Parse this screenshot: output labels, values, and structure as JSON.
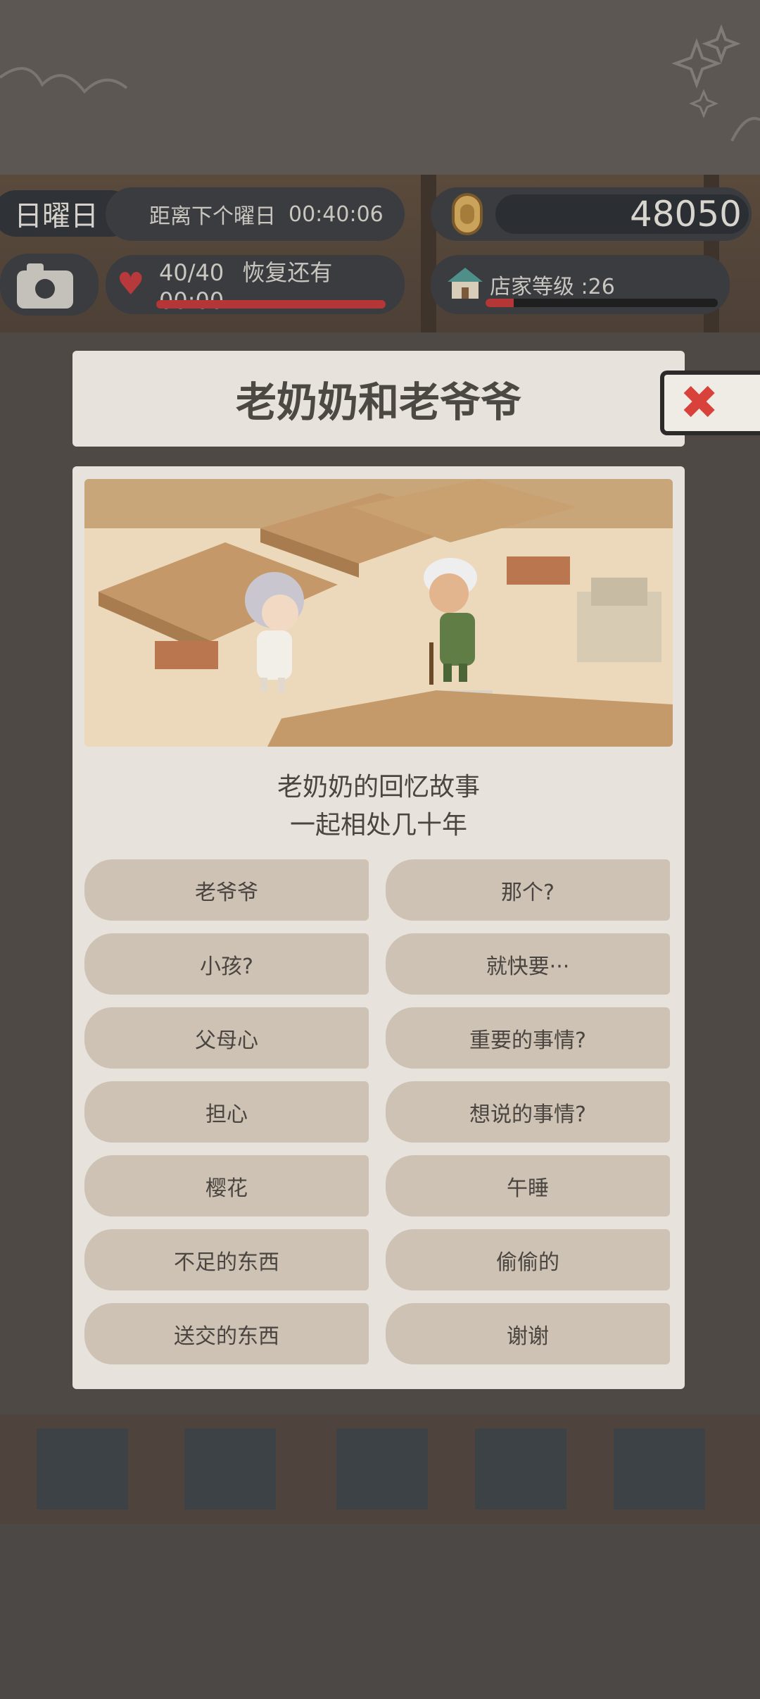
{
  "hud": {
    "day": "日曜日",
    "next_day_label": "距离下个曜日",
    "next_day_timer": "00:40:06",
    "coins": "48050",
    "stamina": "40/40",
    "recover_label": "恢复还有",
    "recover_timer": "00:00",
    "shop_level": "店家等级 :26",
    "stamina_fill": 1.0,
    "level_fill": 0.12
  },
  "dialog": {
    "title": "老奶奶和老爷爷",
    "close_icon": "close-icon",
    "subtitle_line1": "老奶奶的回忆故事",
    "subtitle_line2": "一起相处几十年",
    "options": [
      "老爷爷",
      "那个?",
      "小孩?",
      "就快要···",
      "父母心",
      "重要的事情?",
      "担心",
      "想说的事情?",
      "樱花",
      "午睡",
      "不足的东西",
      "偷偷的",
      "送交的东西",
      "谢谢"
    ]
  },
  "colors": {
    "panel": "#e7e3dc",
    "option": "#cdc2b3",
    "close": "#d9423a",
    "heart": "#b8393b"
  }
}
